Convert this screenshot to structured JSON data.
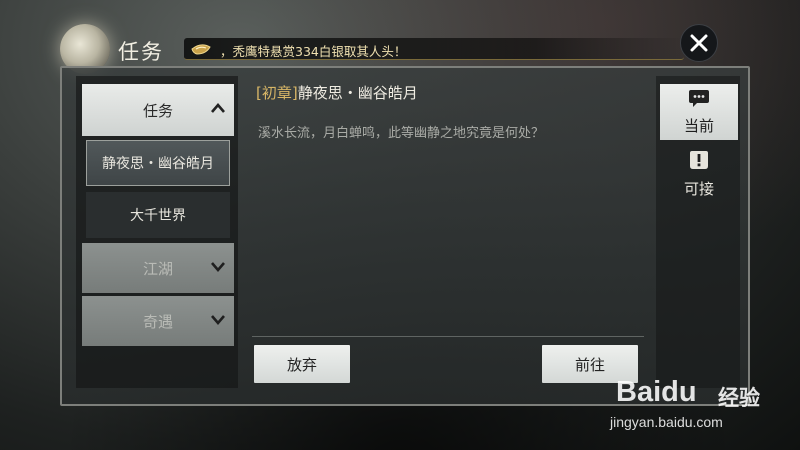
{
  "header": {
    "title": "任务",
    "ticker": "，秃鹰特悬赏334白银取其人头！"
  },
  "sidebar": {
    "primary_tab": "任务",
    "items": [
      {
        "label": "静夜思・幽谷皓月",
        "state": "selected"
      },
      {
        "label": "大千世界",
        "state": "normal"
      }
    ],
    "secondary_tabs": [
      {
        "label": "江湖"
      },
      {
        "label": "奇遇"
      }
    ]
  },
  "quest": {
    "prefix": "[初章]",
    "name": "静夜思・幽谷皓月",
    "description": "溪水长流，月白蝉鸣，此等幽静之地究竟是何处？"
  },
  "actions": {
    "abandon_label": "放弃",
    "goto_label": "前往"
  },
  "right_tabs": [
    {
      "label": "当前",
      "icon": "speech-bubble-icon",
      "active": true
    },
    {
      "label": "可接",
      "icon": "exclamation-scroll-icon",
      "active": false
    }
  ],
  "watermark": {
    "brand": "Baidu",
    "sub": "经验",
    "url": "jingyan.baidu.com"
  },
  "colors": {
    "accent_gold": "#d8b667",
    "panel_border": "#7d7f7b",
    "button_light": "#e9ebe9"
  }
}
